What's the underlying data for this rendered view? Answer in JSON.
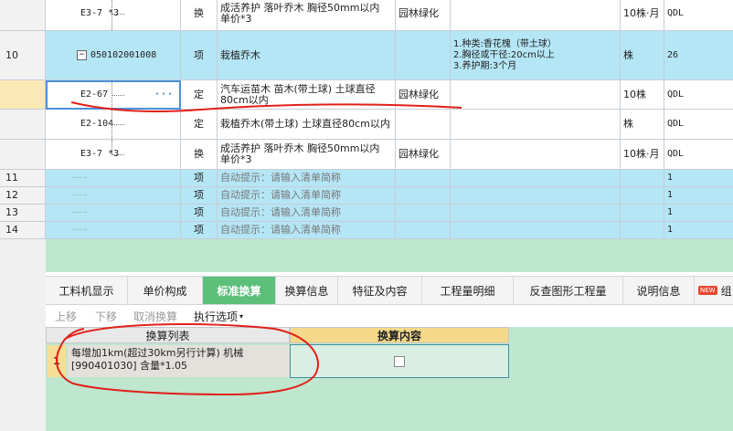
{
  "grid": {
    "rows": [
      {
        "idx": "",
        "code": "E3-7 *3",
        "type": "换",
        "name": "成活养护 落叶乔木 胸径50mm以内 单价*3",
        "spec": "园林绿化",
        "feat": "",
        "unit": "10株·月",
        "qty": "QDL"
      },
      {
        "idx": "10",
        "code": "050102001008",
        "type": "项",
        "name": "栽植乔木",
        "spec": "",
        "feat": "1.种类:香花槐（带土球）\n2.胸径或干径:20cm以上\n3.养护期:3个月",
        "unit": "株",
        "qty": "26"
      },
      {
        "idx": "",
        "code": "E2-67",
        "dots": "···",
        "type": "定",
        "name": "汽车运苗木 苗木(带土球) 土球直径80cm以内",
        "spec": "园林绿化",
        "feat": "",
        "unit": "10株",
        "qty": "QDL"
      },
      {
        "idx": "",
        "code": "E2-104",
        "type": "定",
        "name": "栽植乔木(带土球) 土球直径80cm以内",
        "spec": "",
        "feat": "",
        "unit": "株",
        "qty": "QDL"
      },
      {
        "idx": "",
        "code": "E3-7 *3",
        "type": "换",
        "name": "成活养护 落叶乔木 胸径50mm以内 单价*3",
        "spec": "园林绿化",
        "feat": "",
        "unit": "10株·月",
        "qty": "QDL"
      },
      {
        "idx": "11",
        "code": "",
        "type": "项",
        "name": "自动提示：请输入清单简称",
        "spec": "",
        "feat": "",
        "unit": "",
        "qty": "1"
      },
      {
        "idx": "12",
        "code": "",
        "type": "项",
        "name": "自动提示：请输入清单简称",
        "spec": "",
        "feat": "",
        "unit": "",
        "qty": "1"
      },
      {
        "idx": "13",
        "code": "",
        "type": "项",
        "name": "自动提示：请输入清单简称",
        "spec": "",
        "feat": "",
        "unit": "",
        "qty": "1"
      },
      {
        "idx": "14",
        "code": "",
        "type": "项",
        "name": "自动提示：请输入清单简称",
        "spec": "",
        "feat": "",
        "unit": "",
        "qty": "1"
      }
    ]
  },
  "tabs": [
    "工料机显示",
    "单价构成",
    "标准换算",
    "换算信息",
    "特征及内容",
    "工程量明细",
    "反查图形工程量",
    "说明信息",
    "组"
  ],
  "new_badge": "NEW",
  "toolbar": {
    "up": "上移",
    "down": "下移",
    "cancel": "取消换算",
    "options": "执行选项",
    "arrow": "▾"
  },
  "calc": {
    "header_list": "换算列表",
    "header_content": "换算内容",
    "row_num": "1",
    "row_line1": "每增加1km(超过30km另行计算) 机械",
    "row_line2": "[990401030] 含量*1.05"
  },
  "colors": {
    "row_blue": "#b5e6f6",
    "tab_active": "#5cc07a",
    "panel_green": "#bfe6cf",
    "annotation_red": "#e0201a"
  }
}
